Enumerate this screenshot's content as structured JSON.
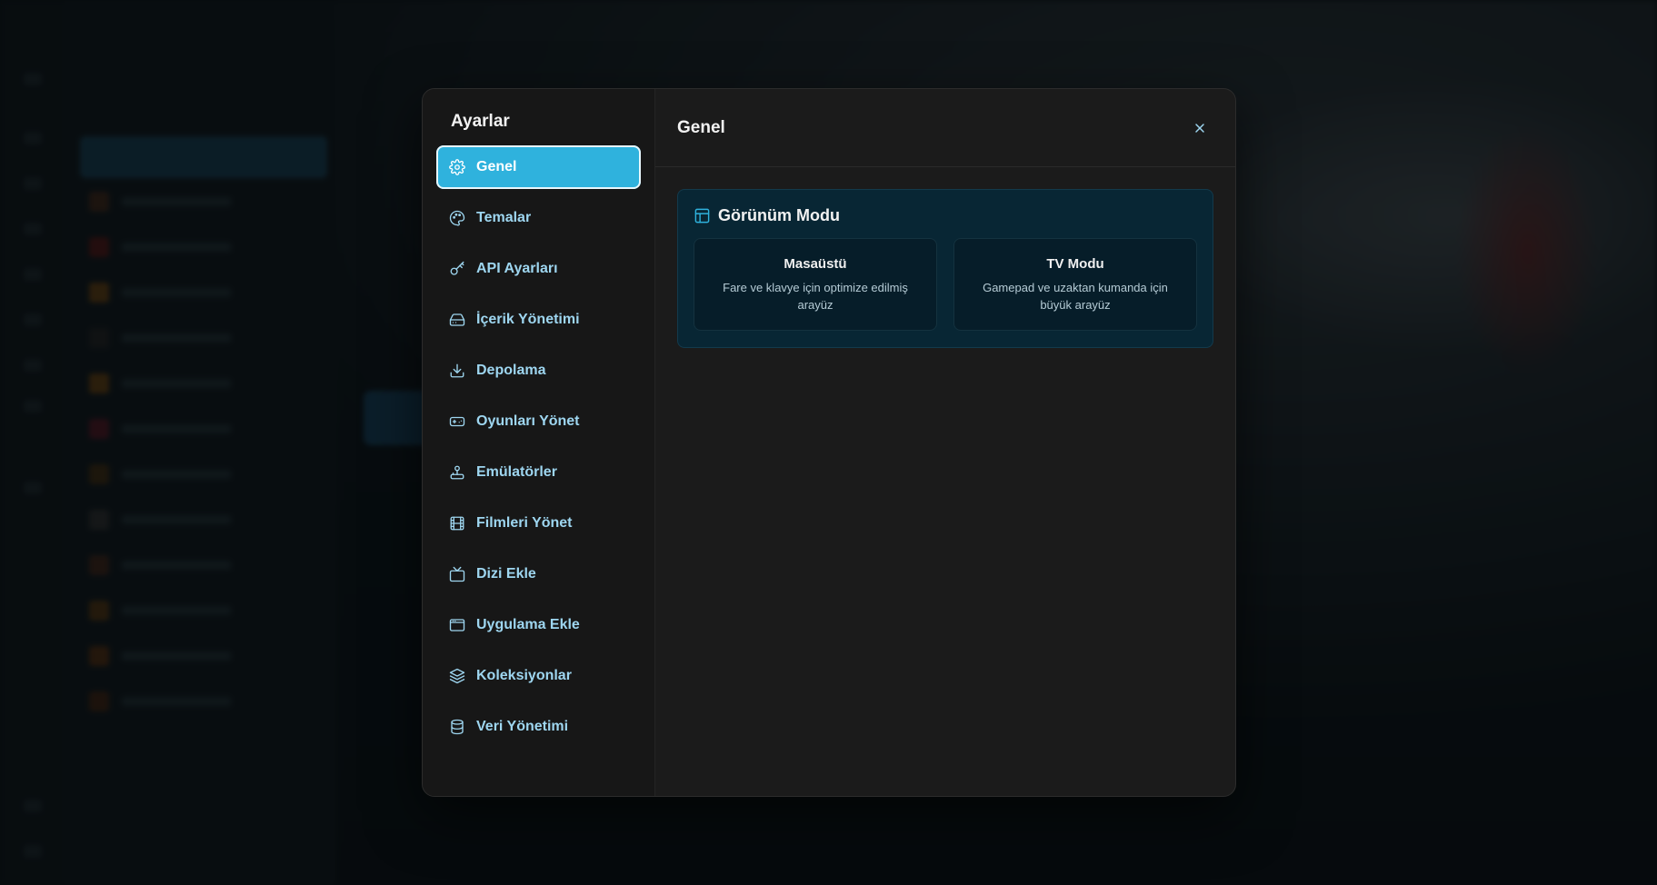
{
  "colors": {
    "accent": "#2fb2dd",
    "nav_text": "#9ed6f0",
    "modal_bg": "#1b1b1b",
    "card_bg": "#082634"
  },
  "settings": {
    "title": "Ayarlar",
    "nav": [
      {
        "label": "Genel",
        "icon": "gear-icon",
        "active": true
      },
      {
        "label": "Temalar",
        "icon": "palette-icon"
      },
      {
        "label": "API Ayarları",
        "icon": "key-icon"
      },
      {
        "label": "İçerik Yönetimi",
        "icon": "hard-drive-icon"
      },
      {
        "label": "Depolama",
        "icon": "download-icon"
      },
      {
        "label": "Oyunları Yönet",
        "icon": "gamepad-icon"
      },
      {
        "label": "Emülatörler",
        "icon": "joystick-icon"
      },
      {
        "label": "Filmleri Yönet",
        "icon": "film-icon"
      },
      {
        "label": "Dizi Ekle",
        "icon": "tv-icon"
      },
      {
        "label": "Uygulama Ekle",
        "icon": "app-window-icon"
      },
      {
        "label": "Koleksiyonlar",
        "icon": "layers-icon"
      },
      {
        "label": "Veri Yönetimi",
        "icon": "database-icon"
      }
    ]
  },
  "main": {
    "title": "Genel",
    "close_icon": "close-icon",
    "view_mode": {
      "title": "Görünüm Modu",
      "icon": "layout-icon",
      "options": [
        {
          "title": "Masaüstü",
          "desc": "Fare ve klavye için optimize edilmiş arayüz"
        },
        {
          "title": "TV Modu",
          "desc": "Gamepad ve uzaktan kumanda için büyük arayüz"
        }
      ]
    }
  }
}
